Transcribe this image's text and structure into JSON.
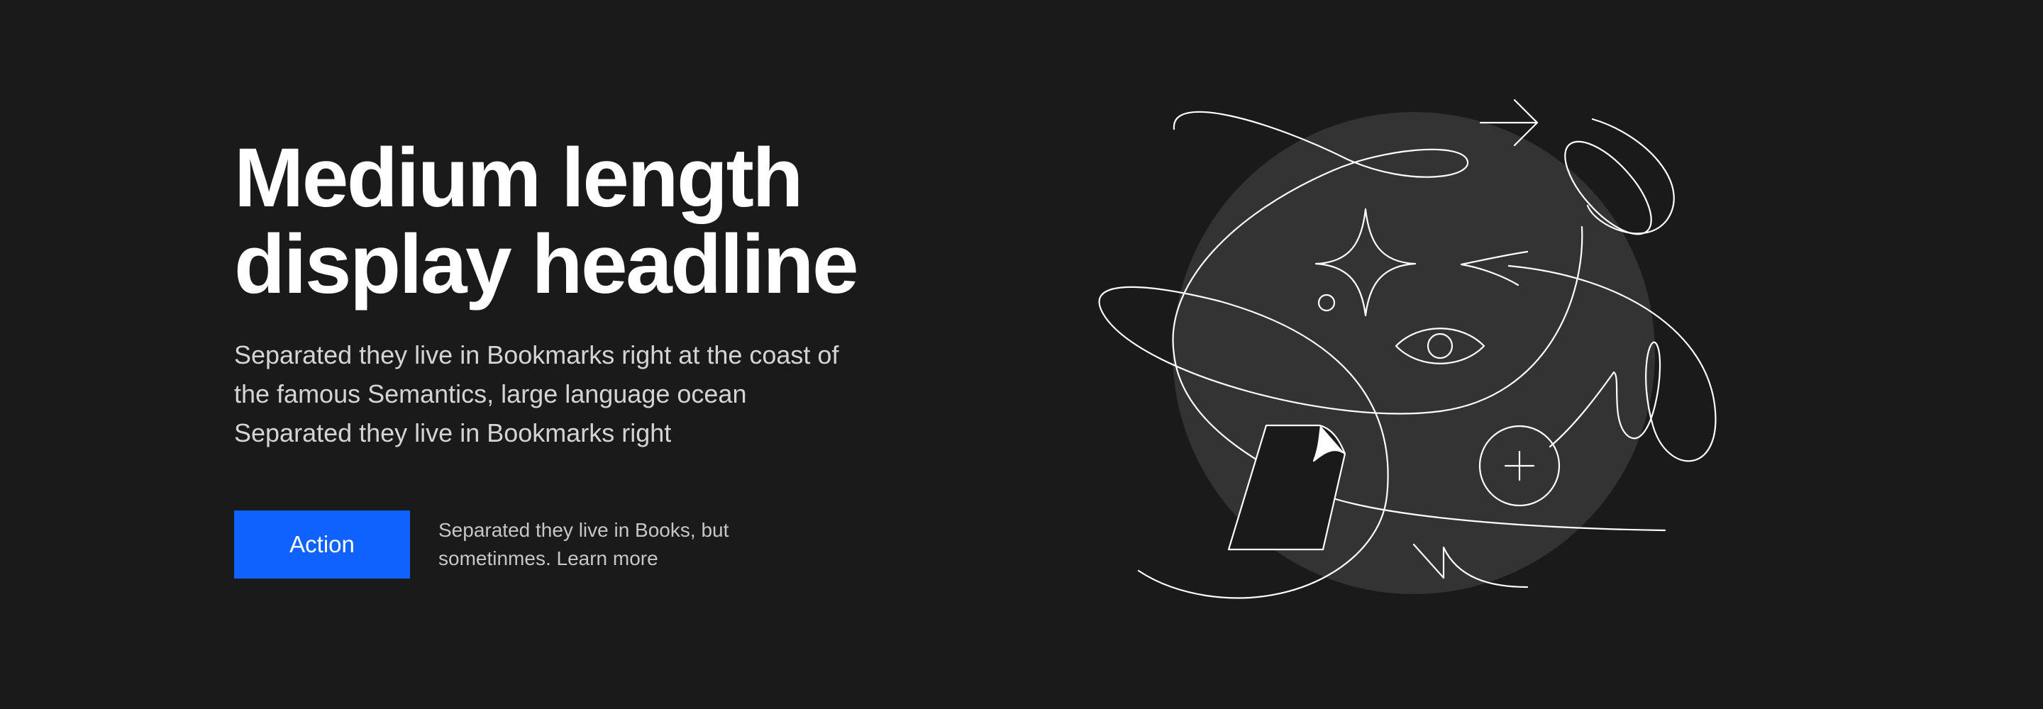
{
  "hero": {
    "headline_line1": "Medium length",
    "headline_line2": "display headline",
    "body_line1": "Separated they live in Bookmarks right at the coast of",
    "body_line2": "the famous Semantics, large language ocean",
    "body_line3": "Separated they live in Bookmarks right",
    "action_label": "Action",
    "caption_line1": "Separated they live in Books, but",
    "caption_line2": "sometinmes. Learn more"
  },
  "colors": {
    "background": "#1a1a1a",
    "accent": "#0f62fe",
    "illustration_circle": "#333333",
    "illustration_stroke": "#ffffff"
  },
  "illustration": {
    "icons": [
      "arrow-right-icon",
      "sparkle-icon",
      "small-circle-icon",
      "eye-icon",
      "plus-circle-icon",
      "document-icon",
      "zigzag-icon"
    ]
  }
}
